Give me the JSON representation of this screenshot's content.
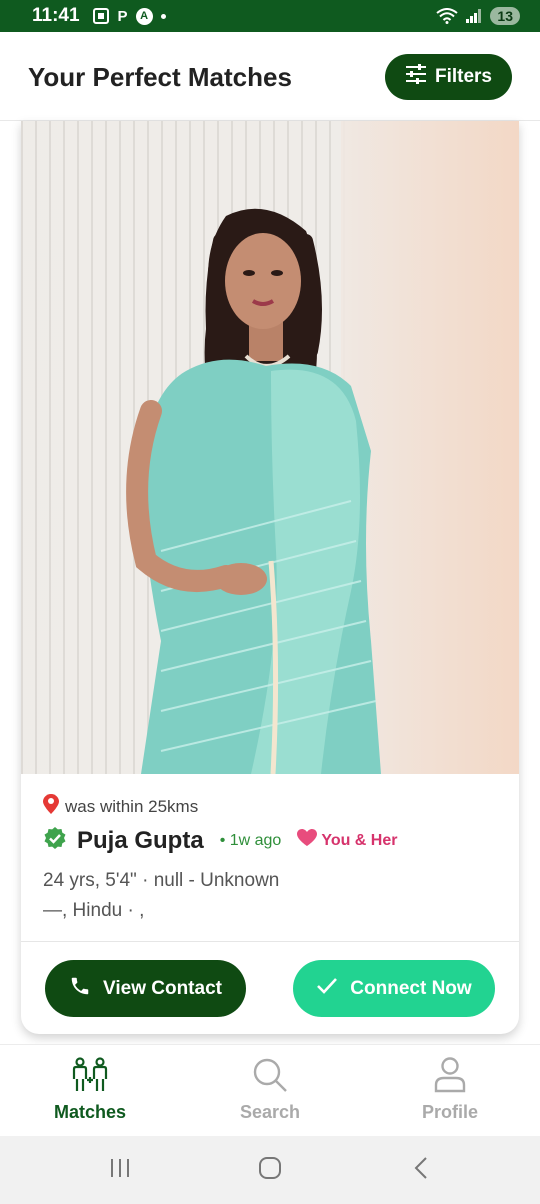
{
  "status_bar": {
    "time": "11:41",
    "p_label": "P",
    "a_label": "A",
    "battery": "13"
  },
  "header": {
    "title": "Your Perfect Matches",
    "filters_label": "Filters"
  },
  "card": {
    "location": "was within 25kms",
    "name": "Puja Gupta",
    "time_ago": "• 1w ago",
    "match_label": "You & Her",
    "details_line1": "24 yrs, 5'4\" · null - Unknown",
    "details_line2": "—, Hindu · ,",
    "view_contact_label": "View Contact",
    "connect_label": "Connect Now"
  },
  "bottom_nav": {
    "items": [
      {
        "label": "Matches",
        "icon": "couple-icon",
        "active": true
      },
      {
        "label": "Search",
        "icon": "search-icon",
        "active": false
      },
      {
        "label": "Profile",
        "icon": "person-icon",
        "active": false
      }
    ]
  },
  "colors": {
    "brand_dark": "#0f4a12",
    "accent_green": "#22d391",
    "status_bar": "#0f5a1f",
    "heart": "#d6336c"
  }
}
